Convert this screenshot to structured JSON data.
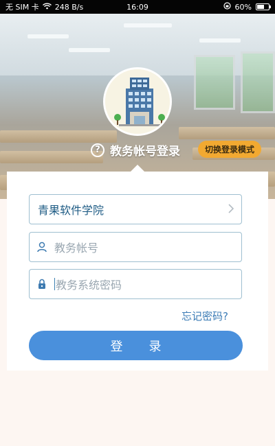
{
  "status_bar": {
    "carrier": "无 SIM 卡",
    "speed": "248 B/s",
    "time": "16:09",
    "battery": "60%",
    "battery_level": 0.6
  },
  "login": {
    "mode_title": "教务帐号登录",
    "switch_mode_label": "切换登录模式",
    "school": "青果软件学院",
    "account_placeholder": "教务帐号",
    "password_placeholder": "教务系统密码",
    "forgot_password": "忘记密码?",
    "submit_label": "登录"
  },
  "icons": {
    "help": "question-circle-icon",
    "user": "user-icon",
    "lock": "lock-icon",
    "chevron": "chevron-right-icon",
    "logo": "school-building-logo"
  },
  "colors": {
    "accent": "#4a90dc",
    "switch_button": "#f2a931",
    "field_border": "#9ebfd0",
    "link": "#3b7bb5"
  }
}
